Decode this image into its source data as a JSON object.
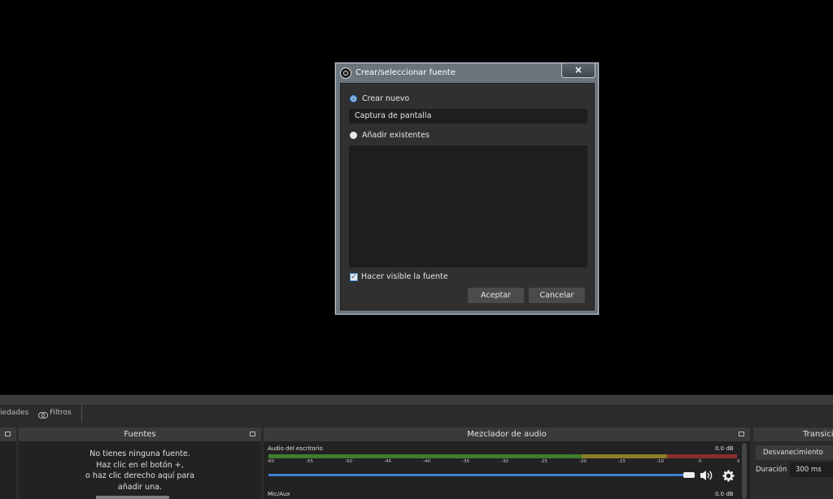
{
  "dialog": {
    "title": "Crear/seleccionar fuente",
    "close_label": "×",
    "create_new_label": "Crear nuevo",
    "source_name_value": "Captura de pantalla",
    "add_existing_label": "Añadir existentes",
    "make_visible_label": "Hacer visible la fuente",
    "make_visible_checked": true,
    "accept_label": "Aceptar",
    "cancel_label": "Cancelar"
  },
  "toolbar": {
    "properties_label": "iedades",
    "filters_label": "Filtros"
  },
  "sources_dock": {
    "title": "Fuentes",
    "empty_line1": "No tienes ninguna fuente.",
    "empty_line2": "Haz clic en el botón +,",
    "empty_line3": "o haz clic derecho aquí para",
    "empty_line4": "añadir una."
  },
  "mixer_dock": {
    "title": "Mezclador de audio",
    "channels": [
      {
        "name": "Audio del escritorio",
        "level": "0.0 dB"
      },
      {
        "name": "Mic/Aux",
        "level": "0.0 dB"
      }
    ],
    "ticks": [
      "-60",
      "-55",
      "-50",
      "-45",
      "-40",
      "-35",
      "-30",
      "-25",
      "-20",
      "-15",
      "-10",
      "-5",
      "0"
    ]
  },
  "transitions_dock": {
    "title": "Transicio",
    "transition_value": "Desvanecimiento",
    "duration_label": "Duración",
    "duration_value": "300 ms"
  },
  "colors": {
    "accent": "#3d7fd1",
    "dialog_frame": "#6a747d"
  }
}
